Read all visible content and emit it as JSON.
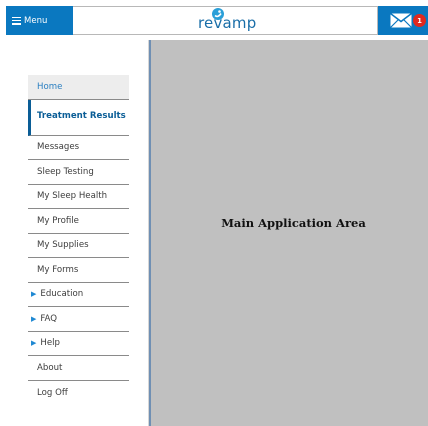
{
  "header": {
    "menu_label": "Menu",
    "logo_text": "revamp",
    "mail_badge_count": "1"
  },
  "sidebar": {
    "items": [
      {
        "label": "Home"
      },
      {
        "label": "Treatment Results"
      },
      {
        "label": "Messages"
      },
      {
        "label": "Sleep Testing"
      },
      {
        "label": "My Sleep Health"
      },
      {
        "label": "My Profile"
      },
      {
        "label": "My Supplies"
      },
      {
        "label": "My Forms"
      },
      {
        "label": "Education"
      },
      {
        "label": "FAQ"
      },
      {
        "label": "Help"
      },
      {
        "label": "About"
      },
      {
        "label": "Log Off"
      }
    ]
  },
  "main": {
    "title": "Main Application Area"
  },
  "icons": {
    "menu": "hamburger-icon",
    "logo": "revamp-logo",
    "mail": "envelope-icon",
    "expand": "triangle-right-icon"
  },
  "colors": {
    "brand_blue": "#0a78c0",
    "active_blue": "#0a5d96",
    "badge_red": "#e0281e",
    "main_bg": "#c0c0c0"
  }
}
